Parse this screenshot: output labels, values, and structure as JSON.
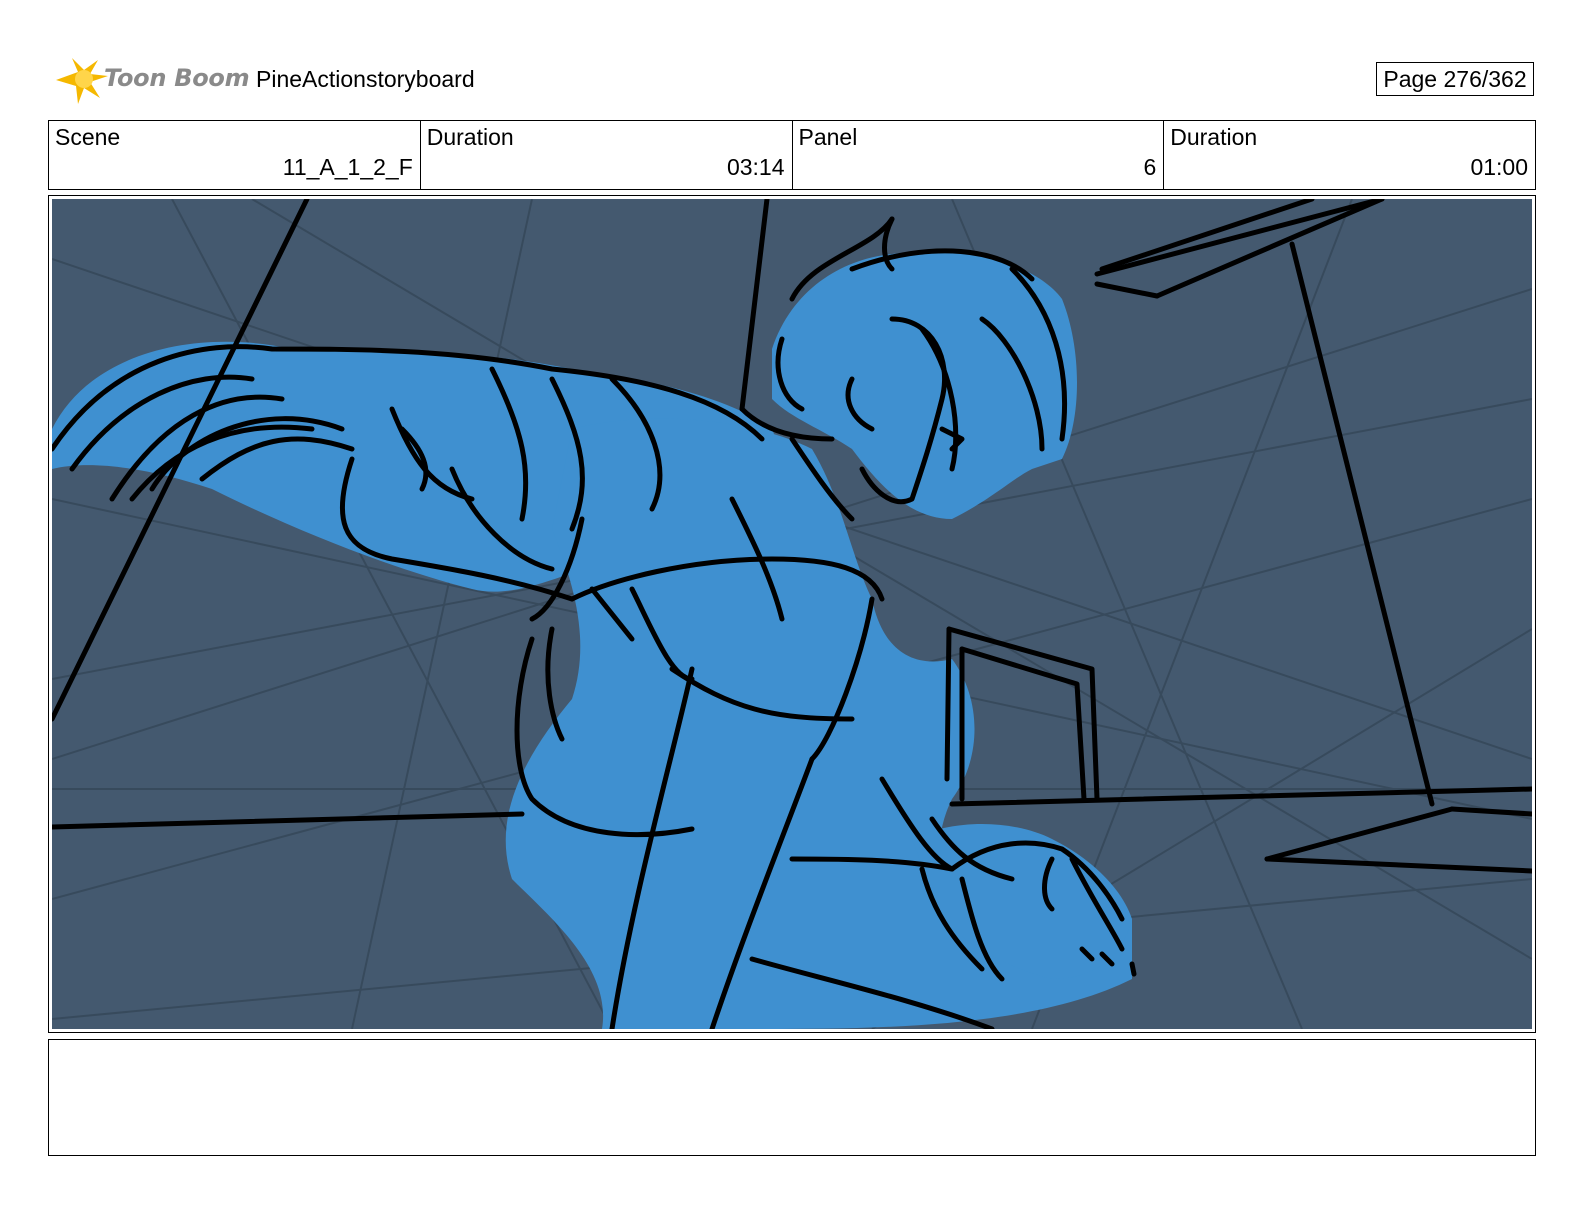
{
  "header": {
    "logo_text": "Toon Boom",
    "project_title": "PineActionstoryboard",
    "page_label": "Page 276/362"
  },
  "info": {
    "scene_label": "Scene",
    "scene_value": "11_A_1_2_F",
    "scene_duration_label": "Duration",
    "scene_duration_value": "03:14",
    "panel_label": "Panel",
    "panel_value": "6",
    "panel_duration_label": "Duration",
    "panel_duration_value": "01:00"
  },
  "colors": {
    "panel_background": "#44596f",
    "character_fill": "#3f90d0",
    "logo_accent": "#f5b800",
    "logo_text": "#8a8a8a"
  },
  "icons": {
    "logo": "starburst-logo-icon"
  },
  "notes": {
    "action_text": ""
  }
}
